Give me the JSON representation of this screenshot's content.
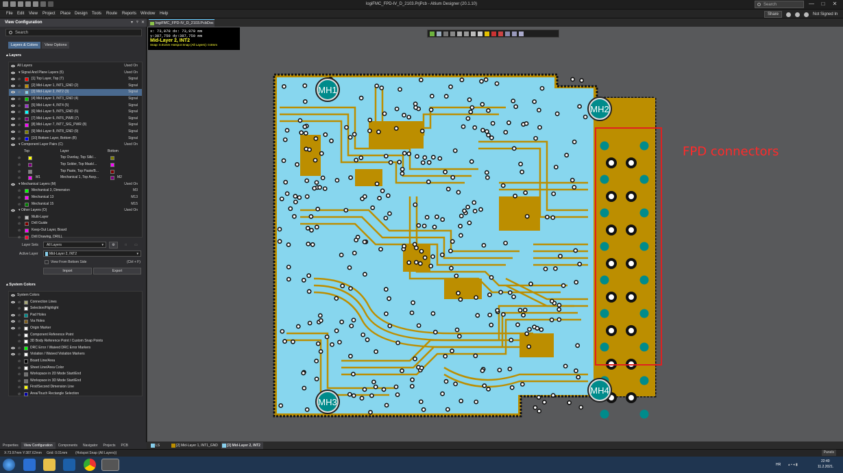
{
  "window": {
    "title": "logiFMC_FPD-IV_D_2103.PrjPcb - Altium Designer (20.1.10)",
    "search_placeholder": "Search",
    "min": "—",
    "max": "□",
    "close": "✕"
  },
  "menu": [
    "File",
    "Edit",
    "View",
    "Project",
    "Place",
    "Design",
    "Tools",
    "Route",
    "Reports",
    "Window",
    "Help"
  ],
  "menu_right": {
    "share": "Share",
    "user": "Not Signed In"
  },
  "panel": {
    "title": "View Configuration",
    "search_placeholder": "Search",
    "tabs": [
      "Layers & Colors",
      "View Options"
    ],
    "layers_section": "Layers",
    "all_layers": {
      "label": "All Layers",
      "used_on": "Used On"
    },
    "signal_group": {
      "label": "Signal And Plane Layers (5)",
      "used_on": "Used On"
    },
    "signal_layers": [
      {
        "name": "[1] Top Layer, Top (T)",
        "type": "Signal",
        "color": "#ff0000",
        "selected": false
      },
      {
        "name": "[2] Mid-Layer 1, INT1_GND (2)",
        "type": "Signal",
        "color": "#bc8e00",
        "selected": false
      },
      {
        "name": "[3] Mid-Layer 2, INT2 (3)",
        "type": "Signal",
        "color": "#87ceeb",
        "selected": true
      },
      {
        "name": "[4] Mid-Layer 3, INT3_GND (4)",
        "type": "Signal",
        "color": "#00cc00",
        "selected": false
      },
      {
        "name": "[5] Mid-Layer 4, INT4 (5)",
        "type": "Signal",
        "color": "#9933cc",
        "selected": false
      },
      {
        "name": "[6] Mid-Layer 5, INT5_GND (6)",
        "type": "Signal",
        "color": "#00ffff",
        "selected": false
      },
      {
        "name": "[7] Mid-Layer 6, INT6_PWR (7)",
        "type": "Signal",
        "color": "#800080",
        "selected": false
      },
      {
        "name": "[8] Mid-Layer 7, INT7_SIG_PWR (8)",
        "type": "Signal",
        "color": "#ff00ff",
        "selected": false
      },
      {
        "name": "[9] Mid-Layer 8, INT8_GND (9)",
        "type": "Signal",
        "color": "#808000",
        "selected": false
      },
      {
        "name": "[10] Bottom Layer, Bottom (B)",
        "type": "Signal",
        "color": "#0000ff",
        "selected": false
      }
    ],
    "pairs_group": {
      "label": "Component Layer Pairs (C)",
      "used_on": "Used On"
    },
    "pairs_header": {
      "top": "Top",
      "layer": "Layer",
      "bottom": "Bottom"
    },
    "pairs": [
      {
        "top_color": "#ffff00",
        "name": "Top Overlay, Top Silk/...",
        "bottom_color": "#808000",
        "tag": ""
      },
      {
        "top_color": "#800080",
        "name": "Top Solder, Top Mask/...",
        "bottom_color": "#ff00ff",
        "tag": ""
      },
      {
        "top_color": "#808080",
        "name": "Top Paste, Top Paste/B...",
        "bottom_color": "#800000",
        "tag": ""
      },
      {
        "top_color": "#ff00ff",
        "name": "Mechanical 1, Top Assy...",
        "bottom_color": "#800080",
        "tag": "M2",
        "top_tag": "M1"
      }
    ],
    "mech_group": {
      "label": "Mechanical Layers (M)",
      "used_on": "Used On"
    },
    "mech": [
      {
        "name": "Mechanical 3, Dimension",
        "color": "#00ff00",
        "tag": "M3"
      },
      {
        "name": "Mechanical 13",
        "color": "#ff00ff",
        "tag": "M13"
      },
      {
        "name": "Mechanical 15",
        "color": "#008000",
        "tag": "M15"
      }
    ],
    "other_group": {
      "label": "Other Layers (O)",
      "used_on": "Used On"
    },
    "other": [
      {
        "name": "Multi-Layer",
        "color": "#c0c0c0"
      },
      {
        "name": "Drill Guide",
        "color": "#800000"
      },
      {
        "name": "Keep-Out Layer, Board",
        "color": "#ff00ff"
      },
      {
        "name": "Drill Drawing, DRILL",
        "color": "#ff0033"
      }
    ],
    "layer_sets_label": "Layer Sets",
    "layer_sets_value": "All Layers",
    "active_layer_label": "Active Layer",
    "active_layer_value": "Mid-Layer 2, INT2",
    "view_bottom": "View From Bottom Side",
    "view_bottom_key": "(Ctrl + F)",
    "import": "Import",
    "export": "Export",
    "system_section": "System Colors",
    "system_header": "System Colors",
    "system": [
      {
        "name": "Connection Lines",
        "color": "#a8a878",
        "eye": true
      },
      {
        "name": "Selection/Highlight",
        "color": "#ffffff",
        "eye": false
      },
      {
        "name": "Pad Holes",
        "color": "#008b8b",
        "eye": true
      },
      {
        "name": "Via Holes",
        "color": "#806020",
        "eye": true
      },
      {
        "name": "Origin Marker",
        "color": "#ffffff",
        "eye": true
      },
      {
        "name": "Component Reference Point",
        "color": "#ffffff",
        "eye": false
      },
      {
        "name": "3D Body Reference Point / Custom Snap Points",
        "color": "#ffffff",
        "eye": false
      },
      {
        "name": "DRC Error / Waived DRC Error Markers",
        "color": "#00ff00",
        "eye": true
      },
      {
        "name": "Violation / Waived Violation Markers",
        "color": "#ffffff",
        "eye": true
      },
      {
        "name": "Board Line/Area",
        "color": "#000000",
        "eye": false
      },
      {
        "name": "Sheet Line/Area Color",
        "color": "#ffffff",
        "eye": false
      },
      {
        "name": "Workspace in 2D Mode Start/End",
        "color": "#707070",
        "eye": false
      },
      {
        "name": "Workspace in 3D Mode Start/End",
        "color": "#707070",
        "eye": false
      },
      {
        "name": "First/Second Dimension Line",
        "color": "#ffff00",
        "eye": false
      },
      {
        "name": "Area/Touch Rectangle Selection",
        "color": "#0000aa",
        "eye": false
      }
    ]
  },
  "doc_tab": "logiFMC_FPD-IV_D_2103.PcbDoc *",
  "hud": {
    "line1": "x: 73,970   dx: 73,970  mm",
    "line2": "y:387,750   dy:387,750  mm",
    "line3": "Mid-Layer 2, INT2",
    "line4": "Snap: 0.01mm Hotspot Snap (All Layers): 0.8mm"
  },
  "annotation": "FPD connectors",
  "board_labels": [
    "MH1",
    "MH2",
    "MH3",
    "MH4"
  ],
  "bottom_tabs": [
    "Properties",
    "View Configuration",
    "Components",
    "Navigator",
    "Projects",
    "PCB"
  ],
  "layer_tabs": [
    {
      "label": "LS",
      "color": "#87ceeb"
    },
    {
      "label": "[2] Mid-Layer 1, INT1_GND",
      "color": "#bc8e00"
    },
    {
      "label": "[3] Mid-Layer 2, INT2",
      "color": "#87ceeb",
      "active": true
    }
  ],
  "status": {
    "coords": "X:73.97mm Y:387.62mm",
    "grid": "Grid: 0.01mm",
    "snap": "(Hotspot Snap (All Layers))",
    "panels": "Panels"
  },
  "tray": {
    "lang": "HR",
    "time": "22:40",
    "date": "11.2.2021."
  },
  "colors": {
    "board_copper": "#bc8e00",
    "board_plane": "#87d6ee",
    "canvas": "#58595b"
  }
}
